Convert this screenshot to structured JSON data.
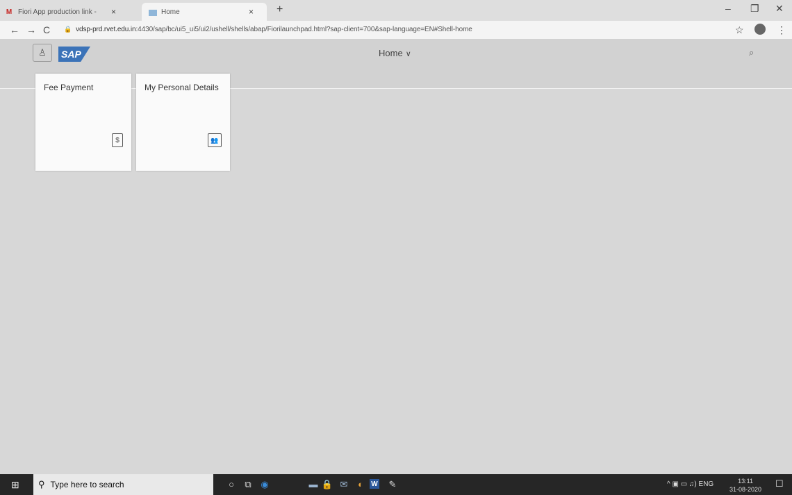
{
  "browser": {
    "tabs": [
      {
        "label": "Fiori App production link - ",
        "icon": "gmail-icon"
      },
      {
        "label": "Home",
        "icon": "sap-page-icon",
        "active": true
      }
    ],
    "close_glyph": "×",
    "new_tab_glyph": "+",
    "window_controls": {
      "minimize": "–",
      "restore": "❐",
      "close": "✕"
    },
    "nav": {
      "back": "←",
      "forward": "→",
      "reload": "C"
    },
    "url_host": "vdsp-prd.rvet.edu.in",
    "url_rest": ":4430/sap/bc/ui5_ui5/ui2/ushell/shells/abap/Fiorilaunchpad.html?sap-client=700&sap-language=EN#Shell-home",
    "bookmark_glyph": "☆",
    "menu_glyph": "⋮"
  },
  "shell": {
    "user_glyph": "♙",
    "logo_text": "SAP",
    "title": "Home",
    "title_chevron": "∨",
    "search_glyph": "⌕"
  },
  "tiles": [
    {
      "title": "Fee Payment",
      "icon": "invoice-icon",
      "icon_glyph": "$"
    },
    {
      "title": "My Personal Details",
      "icon": "personal-details-icon",
      "icon_glyph": "👥"
    }
  ],
  "taskbar": {
    "start_glyph": "⊞",
    "search_placeholder": "Type here to search",
    "search_glyph": "⚲",
    "apps": [
      "○",
      "⧉",
      "◉",
      "▬",
      "🔒",
      "✉",
      "◐",
      "✎"
    ],
    "word_label": "W",
    "tray_text": "^  ▣  ▭  ♫)  ENG",
    "time": "13:11",
    "date": "31-08-2020",
    "notification_glyph": "☐"
  }
}
